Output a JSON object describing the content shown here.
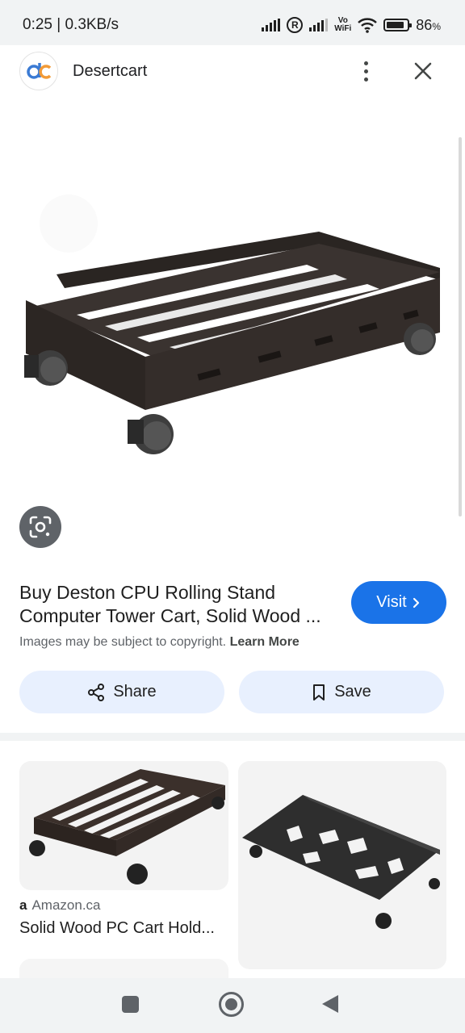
{
  "status_bar": {
    "time_speed": "0:25 | 0.3KB/s",
    "roaming_badge": "R",
    "vowifi_top": "Vo",
    "vowifi_bottom": "WiFi",
    "battery_percent": "86",
    "battery_unit": "%",
    "battery_level": 0.86
  },
  "header": {
    "site_name": "Desertcart",
    "logo_text": "dc"
  },
  "result": {
    "title_line1": "Buy Deston CPU Rolling Stand",
    "title_line2": "Computer Tower Cart, Solid Wood ...",
    "visit_label": "Visit",
    "copyright_text": "Images may be subject to copyright.",
    "learn_more": "Learn More",
    "share_label": "Share",
    "save_label": "Save"
  },
  "related": {
    "items": [
      {
        "source": "Amazon.ca",
        "source_icon": "a",
        "title": "Solid Wood PC Cart Hold..."
      }
    ]
  },
  "colors": {
    "accent": "#1a73e8",
    "chip_bg": "#e8f0fe",
    "logo_blue": "#3b7bd4",
    "logo_orange": "#f29b38"
  },
  "icons": {
    "kebab": "more-vert-icon",
    "close": "close-icon",
    "lens": "google-lens-icon",
    "share": "share-icon",
    "save": "bookmark-icon",
    "visit": "chevron-right-icon"
  }
}
